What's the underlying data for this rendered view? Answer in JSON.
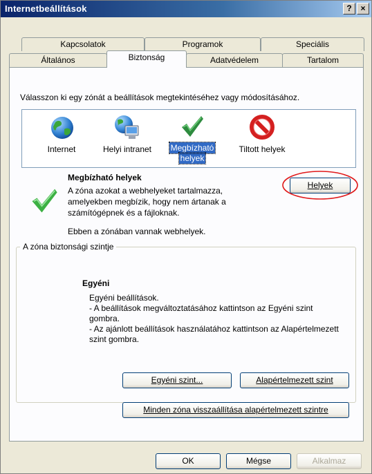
{
  "window": {
    "title": "Internetbeállítások",
    "help_label": "?",
    "close_label": "×"
  },
  "tabs_top": [
    {
      "label": "Kapcsolatok"
    },
    {
      "label": "Programok"
    },
    {
      "label": "Speciális"
    }
  ],
  "tabs_bottom": [
    {
      "label": "Általános"
    },
    {
      "label": "Biztonság"
    },
    {
      "label": "Adatvédelem"
    },
    {
      "label": "Tartalom"
    }
  ],
  "zones": {
    "instruction": "Válasszon ki egy zónát a beállítások megtekintéséhez vagy módosításához.",
    "items": [
      {
        "label": "Internet",
        "icon": "globe-icon"
      },
      {
        "label": "Helyi intranet",
        "icon": "intranet-icon"
      },
      {
        "label_line1": "Megbízható",
        "label_line2": "helyek",
        "icon": "checkmark-icon",
        "selected": true
      },
      {
        "label": "Tiltott helyek",
        "icon": "restricted-icon"
      }
    ]
  },
  "zone_info": {
    "title": "Megbízható helyek",
    "desc_lines": [
      "A zóna azokat a webhelyeket tartalmazza,",
      "amelyekben megbízik, hogy nem ártanak a",
      "számítógépnek és a fájloknak."
    ],
    "status": "Ebben a zónában vannak webhelyek.",
    "sites_button": "Helyek"
  },
  "security_level": {
    "group_title": "A zóna biztonsági szintje",
    "level_name": "Egyéni",
    "lines": [
      "Egyéni beállítások.",
      "- A beállítások megváltoztatásához kattintson az Egyéni szint gombra.",
      "- Az ajánlott beállítások használatához kattintson az Alapértelmezett szint gombra."
    ],
    "custom_button": "Egyéni szint...",
    "default_button": "Alapértelmezett szint"
  },
  "reset_all_button": "Minden zóna visszaállítása alapértelmezett szintre",
  "footer": {
    "ok": "OK",
    "cancel": "Mégse",
    "apply": "Alkalmaz"
  },
  "colors": {
    "titlebar": "#0a246a",
    "selection": "#316ac5",
    "annotation": "#e0191a"
  }
}
